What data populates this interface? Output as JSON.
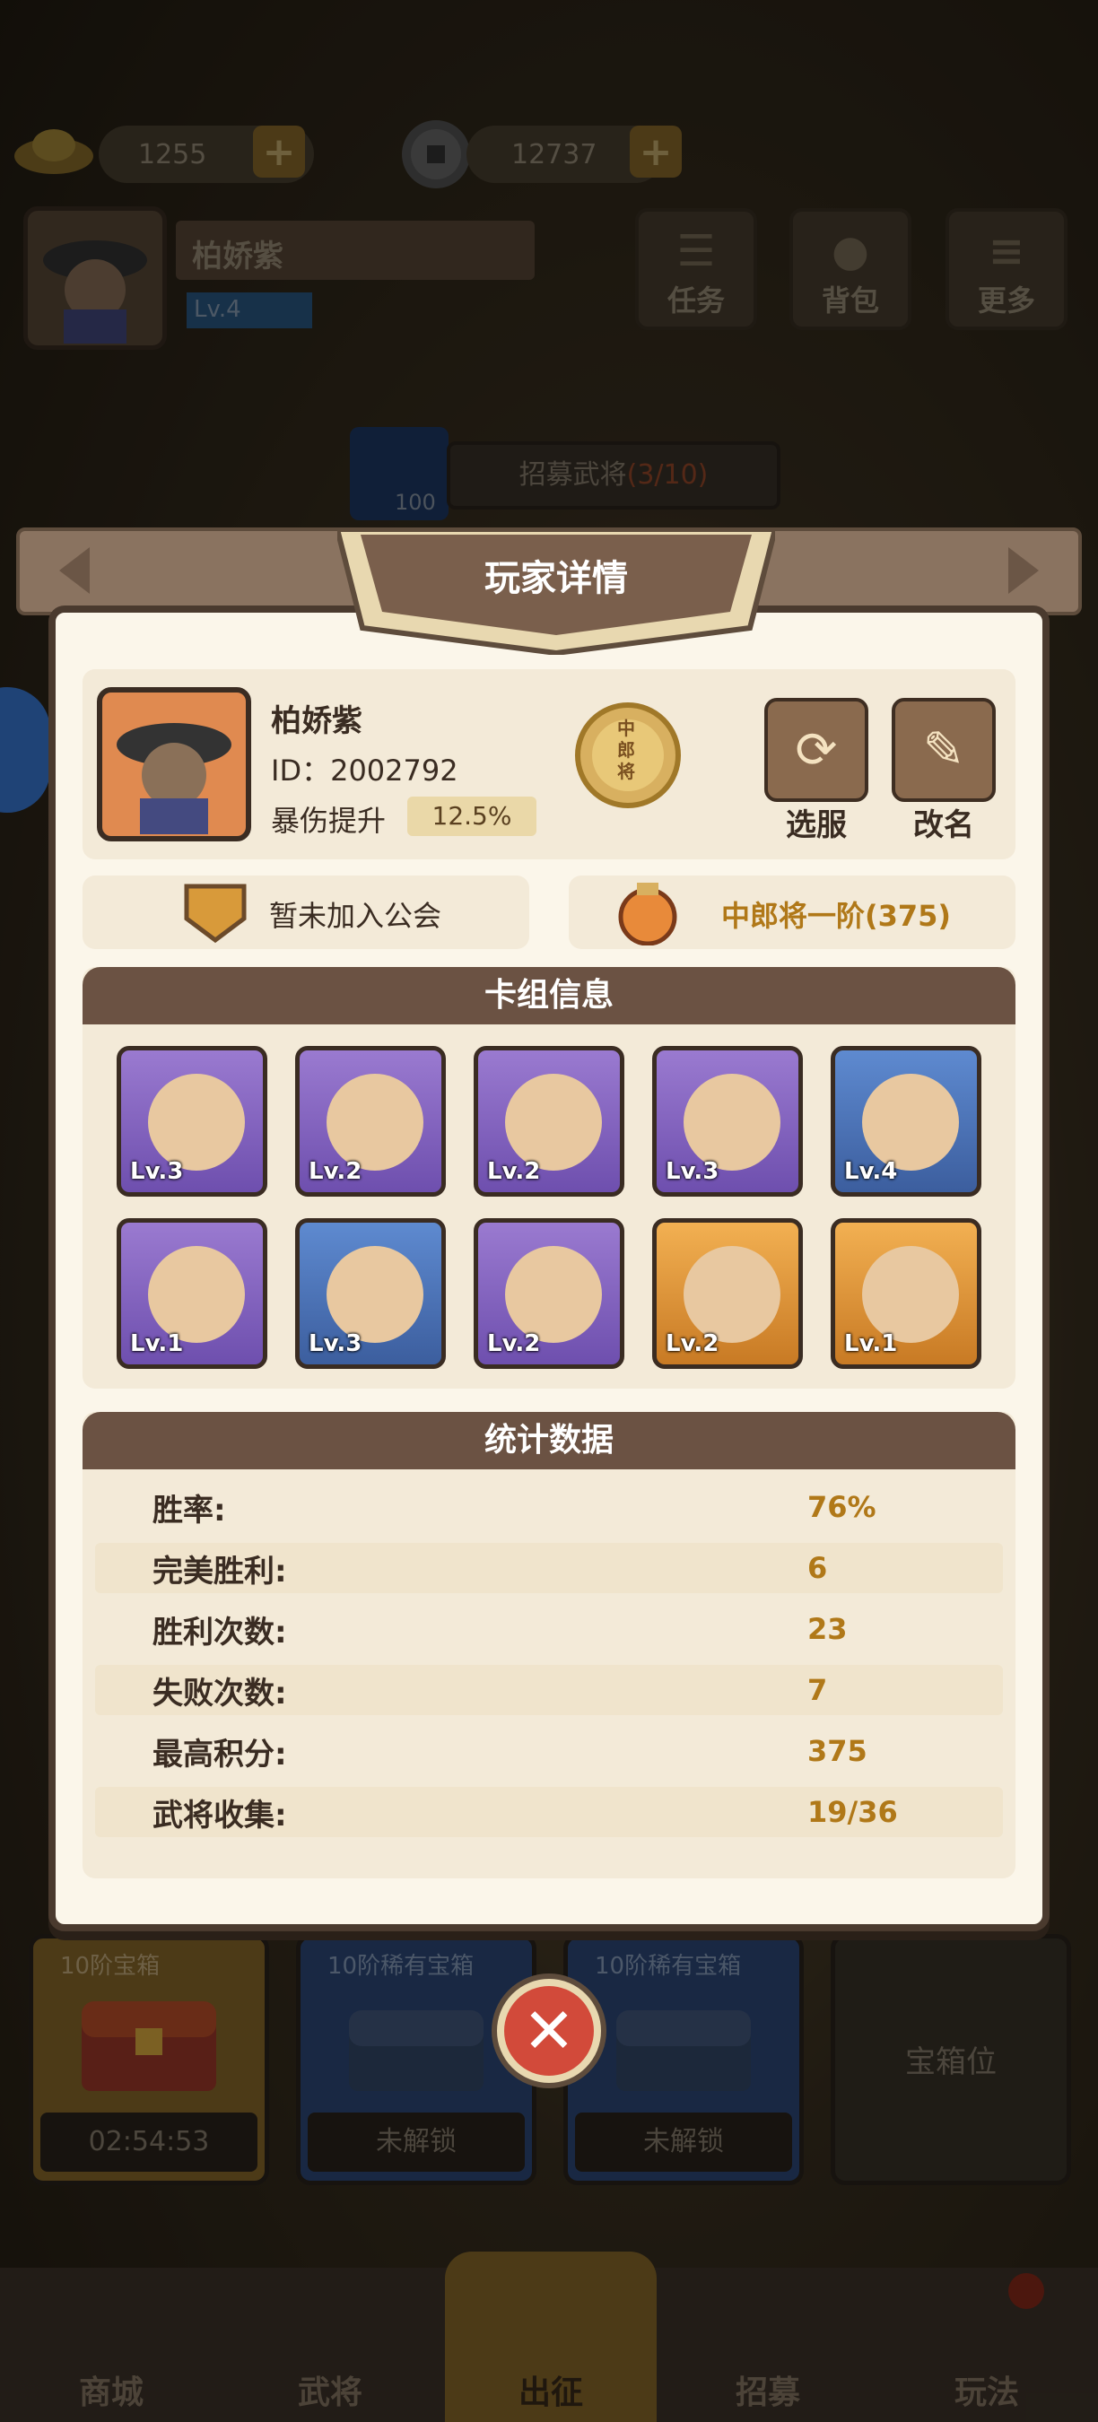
{
  "hud": {
    "gold_amount": "1255",
    "coin_amount": "12737",
    "player_name": "柏娇紫",
    "player_level": "Lv.4",
    "buttons": [
      {
        "label": "任务",
        "icon": "scroll-icon"
      },
      {
        "label": "背包",
        "icon": "bag-icon"
      },
      {
        "label": "更多",
        "icon": "menu-icon"
      }
    ],
    "recruit_cost": "100",
    "recruit_label": "招募武将",
    "recruit_progress": "(3/10)"
  },
  "dialog": {
    "title": "玩家详情",
    "profile": {
      "name": "柏娇紫",
      "id_text": "ID：2002792",
      "crit_label": "暴伤提升",
      "crit_value": "12.5%",
      "rank_badge": "中郎将",
      "server_button": "选服",
      "rename_button": "改名"
    },
    "guild_text": "暂未加入公会",
    "rank_text": "中郎将一阶(375)",
    "deck_title": "卡组信息",
    "deck": [
      {
        "level": "Lv.3",
        "rarity": "purple"
      },
      {
        "level": "Lv.2",
        "rarity": "purple"
      },
      {
        "level": "Lv.2",
        "rarity": "purple"
      },
      {
        "level": "Lv.3",
        "rarity": "purple"
      },
      {
        "level": "Lv.4",
        "rarity": "blue"
      },
      {
        "level": "Lv.1",
        "rarity": "purple"
      },
      {
        "level": "Lv.3",
        "rarity": "blue"
      },
      {
        "level": "Lv.2",
        "rarity": "purple"
      },
      {
        "level": "Lv.2",
        "rarity": "gold"
      },
      {
        "level": "Lv.1",
        "rarity": "gold"
      }
    ],
    "stats_title": "统计数据",
    "stats": [
      {
        "label": "胜率:",
        "value": "76%"
      },
      {
        "label": "完美胜利:",
        "value": "6"
      },
      {
        "label": "胜利次数:",
        "value": "23"
      },
      {
        "label": "失败次数:",
        "value": "7"
      },
      {
        "label": "最高积分:",
        "value": "375"
      },
      {
        "label": "武将收集:",
        "value": "19/36"
      }
    ]
  },
  "chests": [
    {
      "title": "10阶宝箱",
      "status": "02:54:53"
    },
    {
      "title": "10阶稀有宝箱",
      "status": "未解锁"
    },
    {
      "title": "10阶稀有宝箱",
      "status": "未解锁"
    },
    {
      "title": "",
      "status": "宝箱位"
    }
  ],
  "nav": [
    "商城",
    "武将",
    "出征",
    "招募",
    "玩法"
  ],
  "colors": {
    "accent_gold": "#b07818",
    "header_brown": "#6b5243",
    "panel_bg": "#fbf6ea"
  }
}
